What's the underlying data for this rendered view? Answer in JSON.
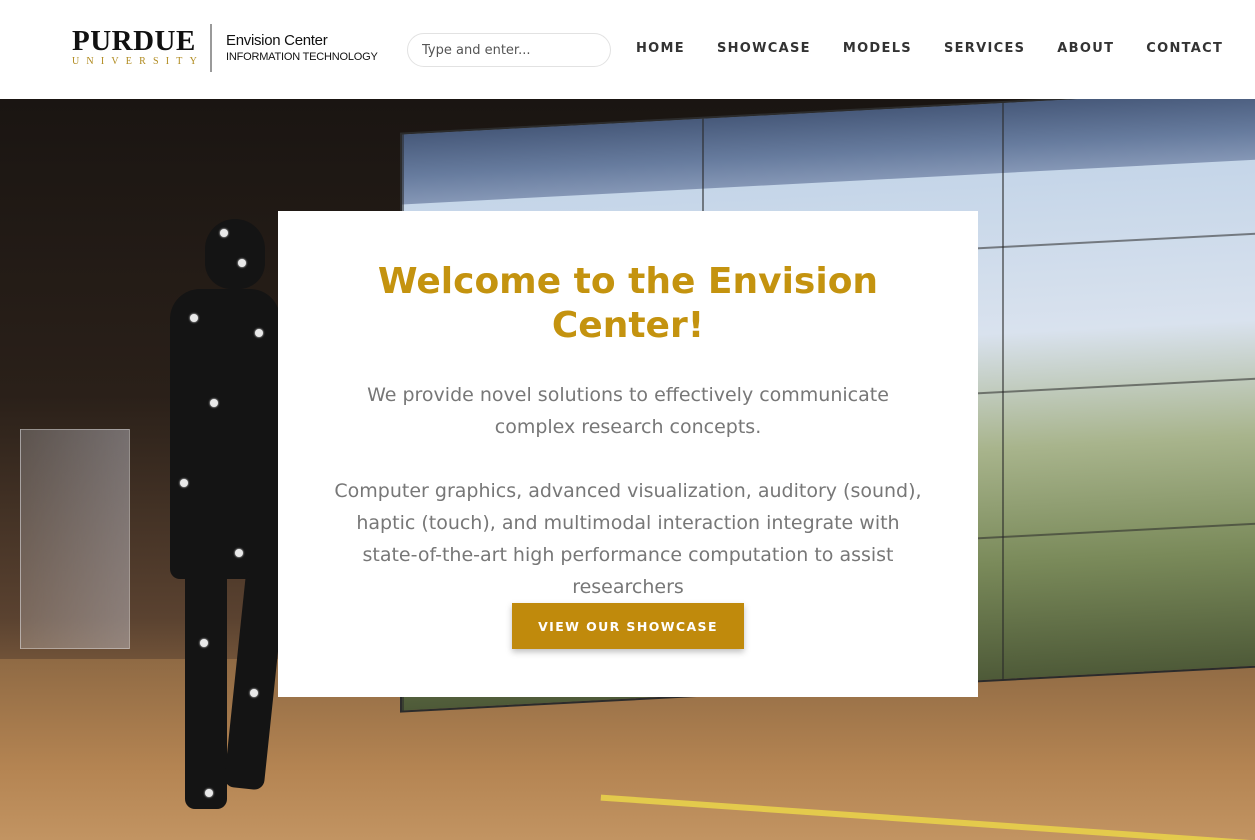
{
  "header": {
    "logo": {
      "purdue": "PURDUE",
      "university": "UNIVERSITY",
      "title": "Envision Center",
      "subtitle": "INFORMATION TECHNOLOGY"
    },
    "search": {
      "placeholder": "Type and enter..."
    },
    "nav": [
      "HOME",
      "SHOWCASE",
      "MODELS",
      "SERVICES",
      "ABOUT",
      "CONTACT"
    ]
  },
  "hero": {
    "title": "Welcome to the Envision Center!",
    "lead": "We provide novel solutions to effectively communicate complex research concepts.",
    "description": "Computer graphics, advanced visualization, auditory (sound), haptic (touch), and multimodal interaction integrate with state-of-the-art high performance computation to assist researchers",
    "button": "VIEW OUR SHOWCASE"
  },
  "colors": {
    "accent_gold": "#c4930f",
    "button_gold": "#c08a0c",
    "text_gray": "#777777",
    "purdue_gold": "#b08a1e"
  },
  "icons": {
    "hero_image": "motion-capture-photo"
  }
}
